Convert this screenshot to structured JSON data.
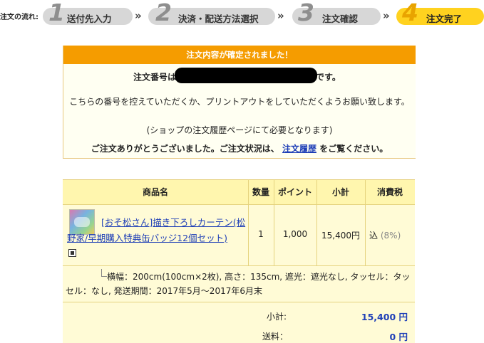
{
  "steps": {
    "label": "注文の流れ:",
    "items": [
      {
        "num": "1",
        "label": "送付先入力"
      },
      {
        "num": "2",
        "label": "決済・配送方法選択"
      },
      {
        "num": "3",
        "label": "注文確認"
      },
      {
        "num": "4",
        "label": "注文完了"
      }
    ],
    "arrow": "»"
  },
  "confirm": {
    "heading": "注文内容が確定されました！",
    "order_prefix": "注文番号は",
    "order_suffix": "です。",
    "para1": "こちらの番号を控えていただくか、プリントアウトをしていただくようお願い致します。",
    "para2": "(ショップの注文履歴ページにて必要となります)",
    "thanks_before": "ご注文ありがとうございました。ご注文状況は、",
    "history_link": "注文履歴",
    "thanks_after": "をご覧ください。"
  },
  "table": {
    "headers": [
      "商品名",
      "数量",
      "ポイント",
      "小計",
      "消費税"
    ],
    "item": {
      "name": "[おそ松さん]描き下ろしカーテン(松野家/早期購入特典缶バッジ12個セット)",
      "quantity": "1",
      "points": "1,000",
      "subtotal": "15,400円",
      "tax_label": "込",
      "tax_rate": "(8%)",
      "options": "横幅：200cm(100cm×2枚), 高さ：135cm, 遮光：遮光なし, タッセル：タッセル：なし, 発送期間：2017年5月～2017年6月末"
    },
    "summary": [
      {
        "label": "小計:",
        "value": "15,400 円"
      },
      {
        "label": "送料：",
        "value": "0 円"
      }
    ]
  }
}
